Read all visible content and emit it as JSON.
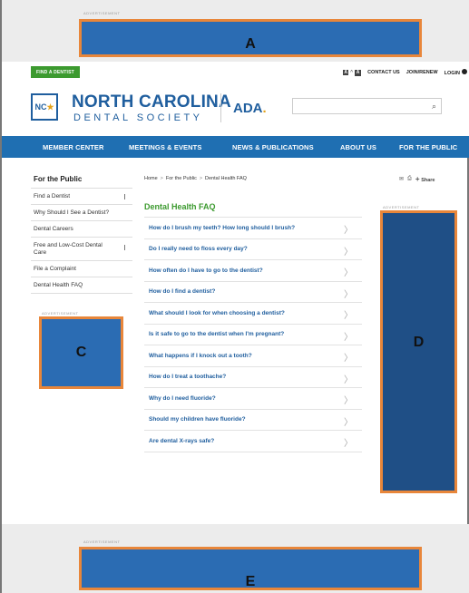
{
  "ads": {
    "label": "ADVERTISEMENT",
    "top_banner": "A",
    "left_square": "C",
    "right_skyscraper": "D",
    "bottom_banner": "E"
  },
  "utility": {
    "find_dentist": "FIND A DENTIST",
    "font_small": "A",
    "font_caret": "^",
    "font_large": "A",
    "contact_us": "CONTACT US",
    "join_renew": "JOIN/RENEW",
    "login": "LOGIN"
  },
  "header": {
    "logo_text": "NC",
    "org_name": "NORTH CAROLINA",
    "org_sub": "DENTAL SOCIETY",
    "ada_logo": "ADA",
    "ada_dot": ".",
    "search_placeholder": ""
  },
  "nav": {
    "items": [
      "MEMBER CENTER",
      "MEETINGS & EVENTS",
      "NEWS & PUBLICATIONS",
      "ABOUT US",
      "FOR THE PUBLIC"
    ]
  },
  "sidebar": {
    "title": "For the Public",
    "items": [
      "Find a Dentist",
      "Why Should I See a Dentist?",
      "Dental Careers",
      "Free and Low-Cost Dental Care",
      "File a Complaint",
      "Dental Health FAQ"
    ]
  },
  "breadcrumb": {
    "home": "Home",
    "sep": ">",
    "section": "For the Public",
    "current": "Dental Health FAQ"
  },
  "share": {
    "label": "Share",
    "plus": "+"
  },
  "faq": {
    "title": "Dental Health FAQ",
    "chevron": "〉",
    "items": [
      "How do I brush my teeth? How long should I brush?",
      "Do I really need to floss every day?",
      "How often do I have to go to the dentist?",
      "How do I find a dentist?",
      "What should I look for when choosing a dentist?",
      "Is it safe to go to the dentist when I'm pregnant?",
      "What happens if I knock out a tooth?",
      "How do I treat a toothache?",
      "Why do I need fluoride?",
      "Should my children have fluoride?",
      "Are dental X-rays safe?"
    ]
  },
  "colors": {
    "brand_blue": "#1f5e9e",
    "nav_blue": "#1f6fb2",
    "green": "#3c9a2f",
    "ad_fill": "#2b6cb3",
    "ad_border": "#e8863a"
  }
}
